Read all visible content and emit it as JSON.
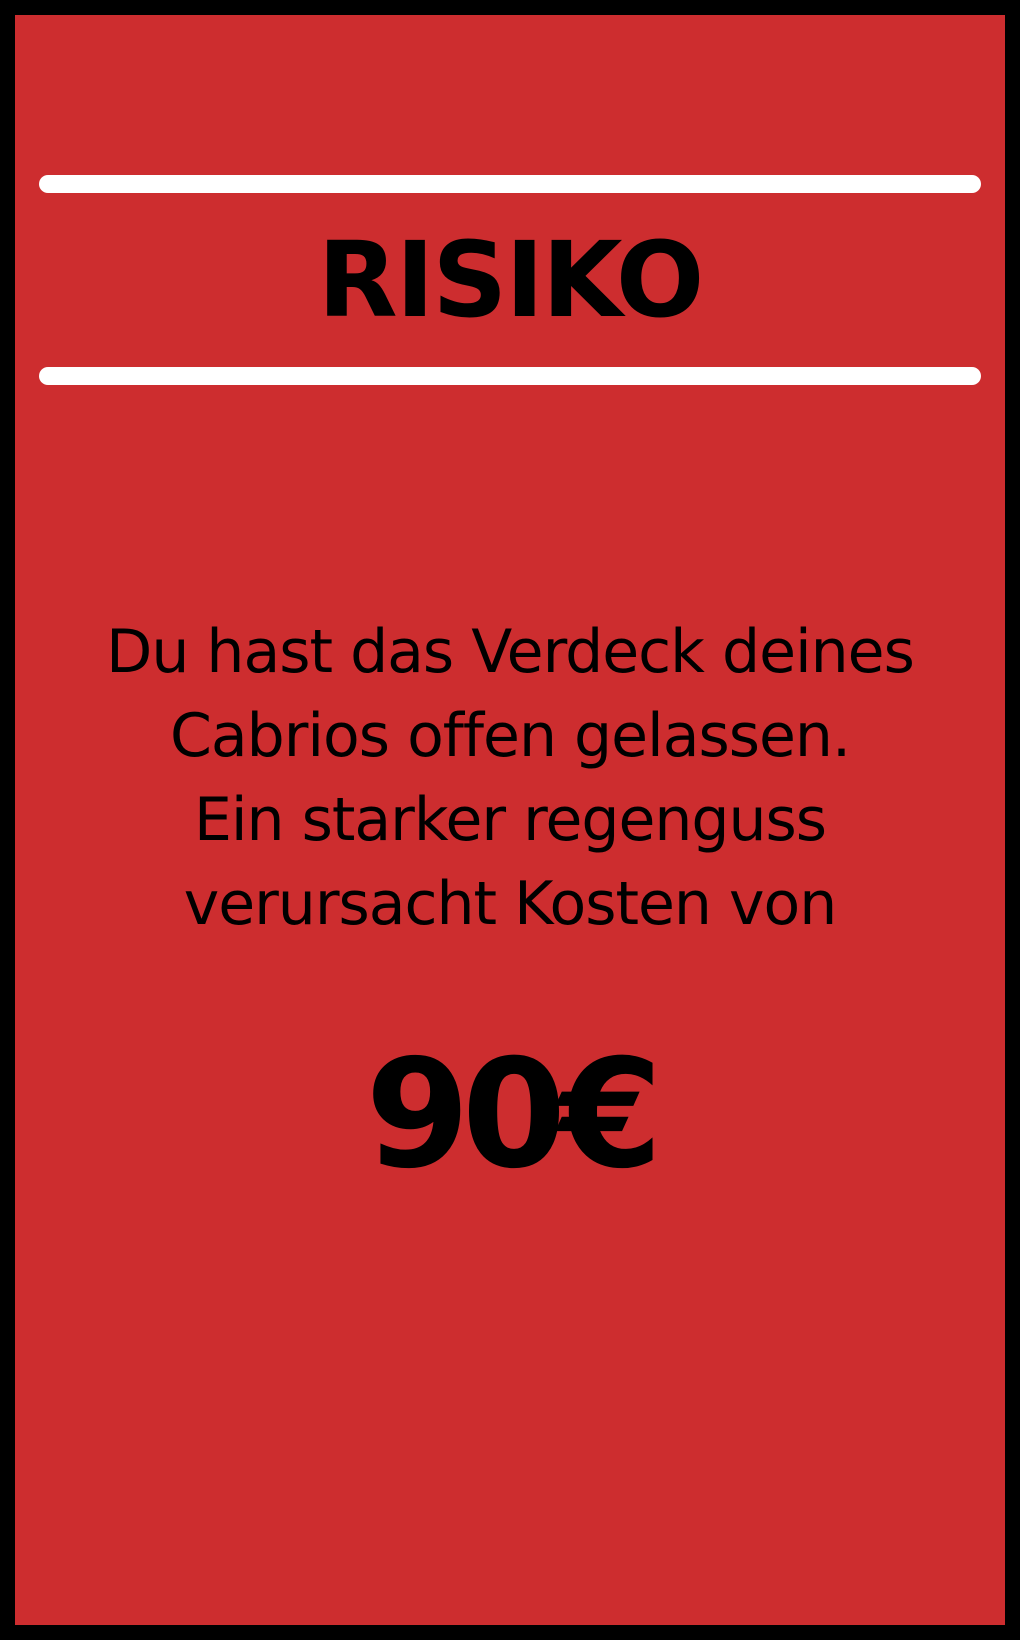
{
  "card": {
    "title": "RISIKO",
    "lines": [
      "Du hast das Verdeck deines",
      "Cabrios offen gelassen.",
      "Ein starker regenguss",
      "verursacht Kosten von"
    ],
    "amount": "90€"
  },
  "colors": {
    "card_background": "#cd2d2f",
    "border": "#000000",
    "rules": "#ffffff",
    "text": "#000000"
  }
}
